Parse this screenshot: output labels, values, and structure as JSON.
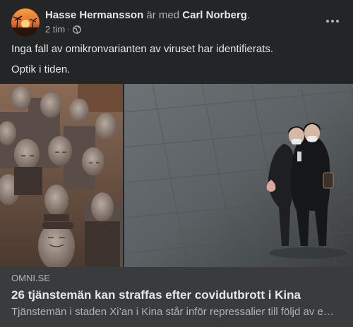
{
  "post": {
    "author": "Hasse Hermansson",
    "with_text": "är med",
    "tagged": "Carl Norberg",
    "tagged_suffix": ".",
    "time": "2 tim",
    "separator": "·",
    "audience_icon": "globe-icon",
    "more_icon": "more-options-icon",
    "text_lines": [
      "Inga fall av omikronvarianten av viruset har identifierats.",
      "Optik i tiden."
    ]
  },
  "images": {
    "left": "terracotta-warriors-photo",
    "right": "two-people-masks-photo"
  },
  "link": {
    "domain": "OMNI.SE",
    "title": "26 tjänstemän kan straffas efter covidutbrott i Kina",
    "description": "Tjänstemän i staden Xi’an i Kina står inför repressalier till följd av e…"
  },
  "colors": {
    "card_bg": "#242526",
    "link_bg": "#3a3b3c",
    "primary_text": "#e4e6eb",
    "secondary_text": "#b0b3b8"
  }
}
